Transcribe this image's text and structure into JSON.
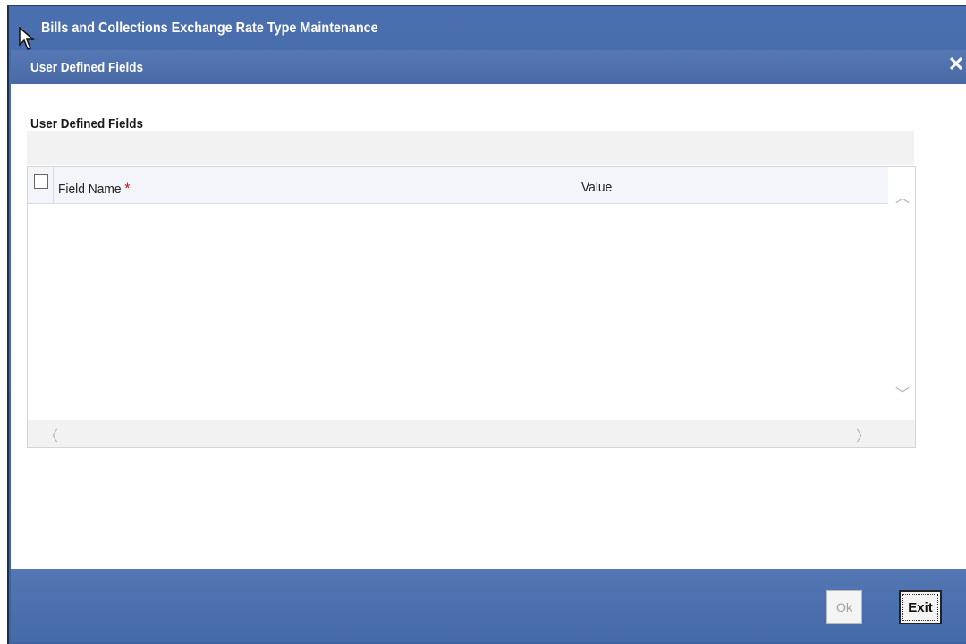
{
  "window": {
    "title": "Bills and Collections Exchange Rate Type Maintenance"
  },
  "dialog": {
    "title": "User Defined Fields",
    "close_icon": "close-icon",
    "close_glyph": "✕"
  },
  "section": {
    "heading": "User Defined Fields"
  },
  "grid": {
    "columns": [
      {
        "label": "Field Name",
        "required_marker": "*"
      },
      {
        "label": "Value"
      }
    ],
    "rows": [],
    "scroll_up_glyph": "︿",
    "scroll_down_glyph": "﹀",
    "scroll_left_glyph": "〈",
    "scroll_right_glyph": "〉"
  },
  "footer": {
    "ok_label": "Ok",
    "exit_label": "Exit"
  },
  "colors": {
    "title_bar": "#4a6aa6",
    "footer": "#456aa8",
    "required": "#d01010"
  }
}
